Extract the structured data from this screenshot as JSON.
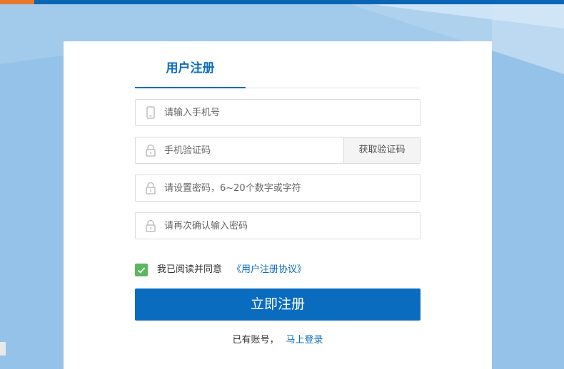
{
  "theme": {
    "primary": "#0a6cbf",
    "background": "#94c2e8",
    "checkbox": "#5cb85c"
  },
  "tabs": {
    "register_label": "用户注册"
  },
  "form": {
    "phone_placeholder": "请输入手机号",
    "sms_code_placeholder": "手机验证码",
    "get_code_label": "获取验证码",
    "password_placeholder": "请设置密码，6~20个数字或字符",
    "confirm_password_placeholder": "请再次确认输入密码"
  },
  "agreement": {
    "checked": true,
    "text": "我已阅读并同意",
    "link_text": "《用户注册协议》"
  },
  "submit_label": "立即注册",
  "footer": {
    "has_account_text": "已有账号，",
    "login_link": "马上登录"
  },
  "icons": {
    "phone": "phone-icon",
    "lock": "lock-icon",
    "check": "check-icon"
  }
}
